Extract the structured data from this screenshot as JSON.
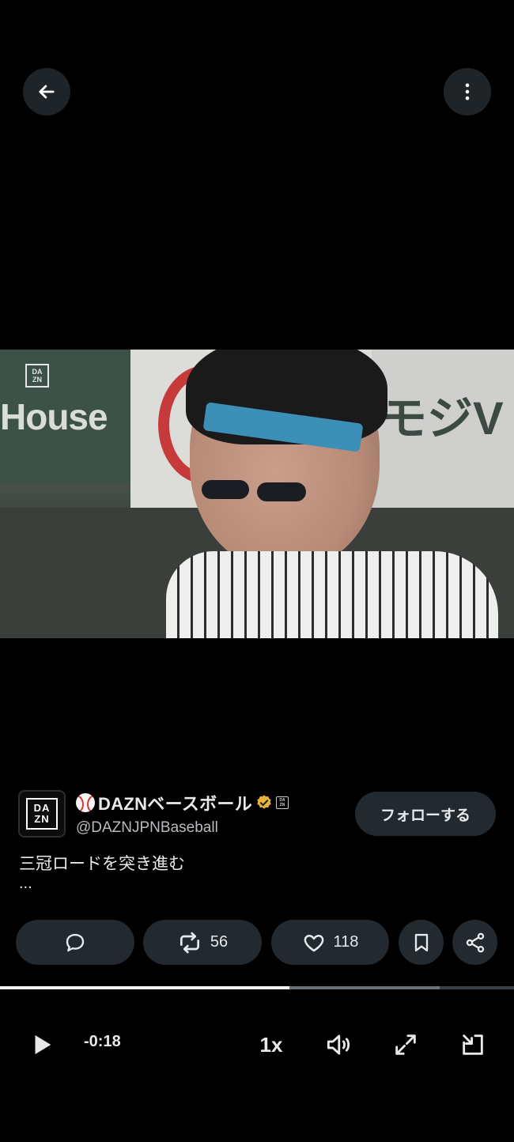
{
  "header": {
    "back_icon": "arrow-left-icon",
    "more_icon": "vertical-dots-icon"
  },
  "video": {
    "watermark": [
      "DA",
      "ZN"
    ],
    "sign_left_text": "House",
    "sign_right_text": "モジV"
  },
  "account": {
    "avatar_logo": [
      "DA",
      "ZN"
    ],
    "emoji": "⚾",
    "display_name": "DAZNベースボール",
    "verified_color": "#e8b339",
    "affiliate_badge": [
      "DA",
      "ZN"
    ],
    "handle": "@DAZNJPNBaseball",
    "follow_label": "フォローする"
  },
  "tweet": {
    "text": "三冠ロードを突き進む",
    "ellipsis": "..."
  },
  "actions": {
    "reply_count": "",
    "repost_count": "56",
    "like_count": "118"
  },
  "player": {
    "played_fraction": 0.563,
    "buffered_fraction": 0.855,
    "time_remaining": "-0:18",
    "speed_label": "1x"
  }
}
